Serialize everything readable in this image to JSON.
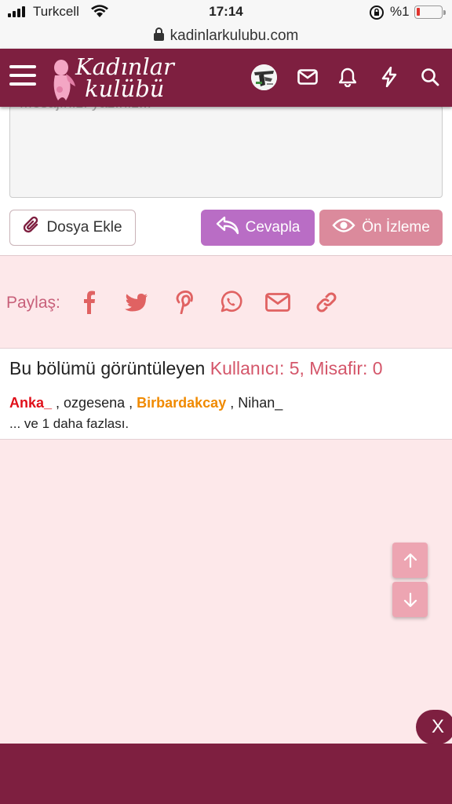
{
  "status_bar": {
    "carrier": "Turkcell",
    "time": "17:14",
    "battery": "%1",
    "battery_level": 0.01
  },
  "browser": {
    "url": "kadinlarkulubu.com"
  },
  "header": {
    "logo_line1": "Kadınlar",
    "logo_line2": "kulübü",
    "icons": [
      "menu-icon",
      "avatar",
      "mail-icon",
      "bell-icon",
      "bolt-icon",
      "search-icon"
    ]
  },
  "editor": {
    "placeholder": "Mesajınızı yazınız...",
    "attach_label": "Dosya Ekle",
    "reply_label": "Cevapla",
    "preview_label": "Ön İzleme"
  },
  "share": {
    "label": "Paylaş:",
    "icons": [
      "facebook-icon",
      "twitter-icon",
      "pinterest-icon",
      "whatsapp-icon",
      "email-icon",
      "link-icon"
    ]
  },
  "viewers": {
    "title": "Bu bölümü görüntüleyen",
    "count": "Kullanıcı: 5, Misafir: 0",
    "users": [
      {
        "name": "Anka_",
        "style": "red"
      },
      {
        "name": "ozgesena",
        "style": "normal"
      },
      {
        "name": "Birbardakcay",
        "style": "orange"
      },
      {
        "name": "Nihan_",
        "style": "normal"
      }
    ],
    "separator": " , ",
    "more": "... ve 1 daha fazlası."
  },
  "controls": {
    "close": "X"
  },
  "colors": {
    "brand": "#7e1f40",
    "accent_pink": "#d4566a",
    "reply_button": "#b96dc5",
    "preview_button": "#db8a9c",
    "page_bg": "#fde8ea"
  }
}
